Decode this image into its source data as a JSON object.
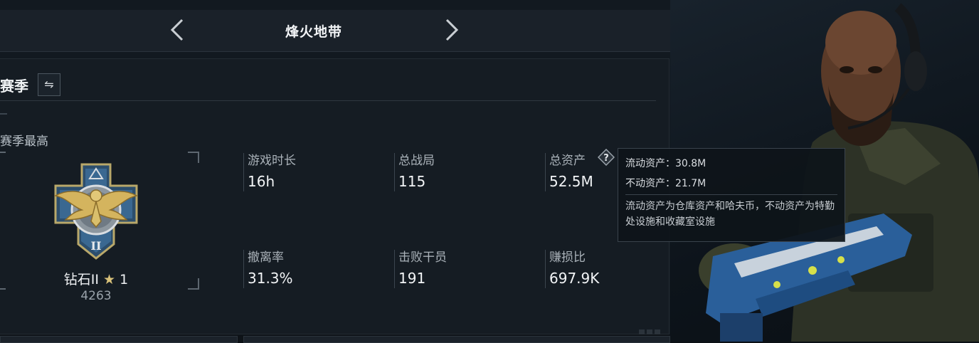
{
  "header": {
    "mode_title": "烽火地带"
  },
  "season": {
    "label": "赛季",
    "switch_glyph": "⇋"
  },
  "season_best": {
    "label": "赛季最高",
    "rank_name": "钻石II",
    "rank_star_glyph": "★",
    "rank_level": "1",
    "rank_score": "4263"
  },
  "stats": [
    {
      "label": "游戏时长",
      "value": "16h"
    },
    {
      "label": "总战局",
      "value": "115"
    },
    {
      "label": "总资产",
      "value": "52.5M"
    },
    {
      "label": "撤离率",
      "value": "31.3%"
    },
    {
      "label": "击败干员",
      "value": "191"
    },
    {
      "label": "赚损比",
      "value": "697.9K"
    }
  ],
  "tooltip": {
    "liquid": "流动资产：30.8M",
    "fixed": "不动资产：21.7M",
    "note": "流动资产为仓库资产和哈夫币，不动资产为特勤处设施和收藏室设施"
  },
  "colors": {
    "background": "#121920",
    "panel": "#151c23",
    "accent_gold": "#d9c27a",
    "emblem_blue": "#3f6f9a"
  },
  "icons": {
    "prev": "chevron-left-icon",
    "next": "chevron-right-icon",
    "switch": "swap-icon",
    "help": "question-icon",
    "emblem": "eagle-rank-emblem"
  }
}
